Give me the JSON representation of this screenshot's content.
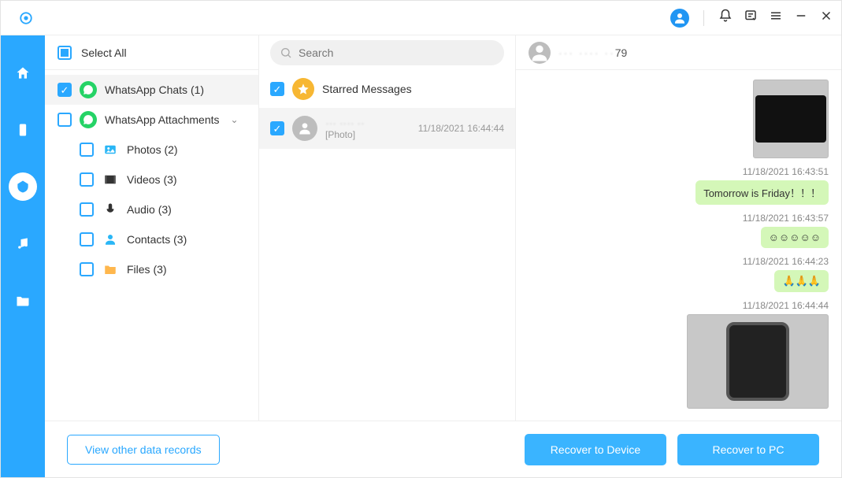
{
  "sidebar": {
    "select_all_label": "Select All",
    "whatsapp_chats_label": "WhatsApp Chats (1)",
    "whatsapp_attachments_label": "WhatsApp Attachments",
    "children": {
      "photos": "Photos (2)",
      "videos": "Videos (3)",
      "audio": "Audio (3)",
      "contacts": "Contacts (3)",
      "files": "Files (3)"
    }
  },
  "search": {
    "placeholder": "Search"
  },
  "list": {
    "starred_label": "Starred Messages",
    "item1": {
      "sub": "[Photo]",
      "ts": "11/18/2021 16:44:44"
    }
  },
  "chat_header": {
    "name_visible": "79"
  },
  "messages": {
    "m1_ts": "11/18/2021 16:43:51",
    "m1_text": "Tomorrow is Friday！！！",
    "m2_ts": "11/18/2021 16:43:57",
    "m2_text": "☺☺☺☺☺",
    "m3_ts": "11/18/2021 16:44:23",
    "m3_text": "🙏🙏🙏",
    "m4_ts": "11/18/2021 16:44:44"
  },
  "bottom": {
    "view_other": "View other data records",
    "recover_device": "Recover to Device",
    "recover_pc": "Recover to PC"
  }
}
